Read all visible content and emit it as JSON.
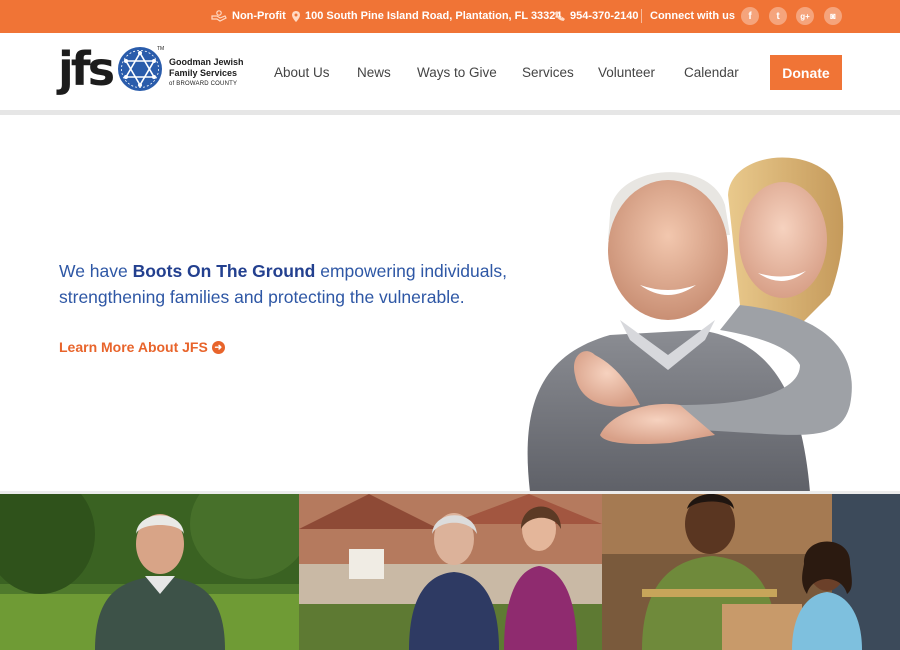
{
  "topbar": {
    "nonprofit": "Non-Profit",
    "address": "100 South Pine Island Road, Plantation, FL 33324",
    "phone": "954-370-2140",
    "connect": "Connect with us",
    "social": [
      {
        "icon": "facebook-icon",
        "glyph": "f"
      },
      {
        "icon": "twitter-icon",
        "glyph": "t"
      },
      {
        "icon": "google-plus-icon",
        "glyph": "g+"
      },
      {
        "icon": "instagram-icon",
        "glyph": "◙"
      }
    ]
  },
  "logo": {
    "mark": "jfs",
    "tm": "TM",
    "line1": "Goodman Jewish",
    "line2": "Family Services",
    "line3": "of BROWARD COUNTY"
  },
  "nav": {
    "about": "About Us",
    "news": "News",
    "ways": "Ways to Give",
    "services": "Services",
    "volunteer": "Volunteer",
    "calendar": "Calendar",
    "donate": "Donate"
  },
  "hero": {
    "text_pre": "We have ",
    "text_bold": "Boots On The Ground",
    "text_post": " empowering individuals, strengthening families and protecting the vulnerable.",
    "learn_more": "Learn More About JFS",
    "arrow_icon": "circle-arrow-right-icon"
  },
  "colors": {
    "brand_orange": "#f07436",
    "brand_blue": "#2e57a5",
    "logo_blue": "#2a5cab"
  }
}
